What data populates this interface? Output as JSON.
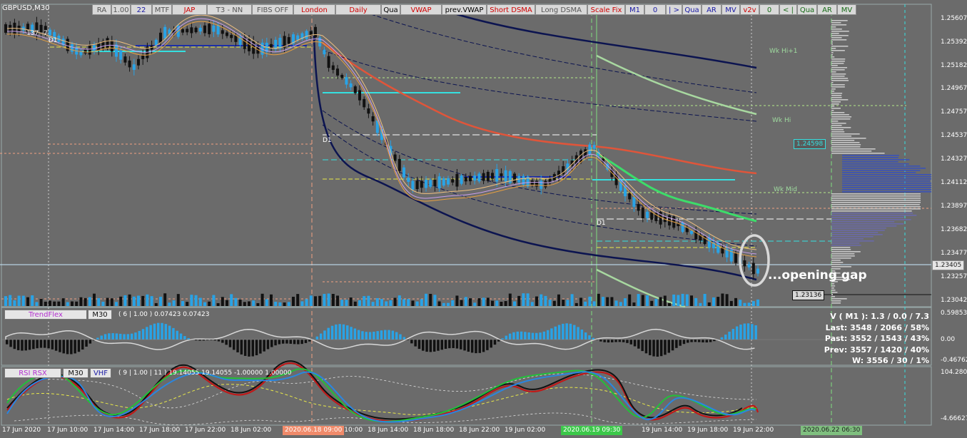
{
  "window": {
    "symbol": "GBPUSD,M30"
  },
  "toolbar": {
    "buttons": [
      "RA",
      "1.00",
      "22",
      "MTF",
      "JAP",
      "T3 - NN",
      "FIBS OFF",
      "London",
      "Daily",
      "Qua",
      "VWAP",
      "prev.VWAP",
      "Short DSMA",
      "Long DSMA",
      "Scale Fix",
      "M1",
      "0",
      "| >",
      "Qua",
      "AR",
      "MV",
      "v2v",
      "0",
      "< |",
      "Qua",
      "AR",
      "MV"
    ]
  },
  "chart": {
    "price_labels": [
      "1.25607",
      "1.25392",
      "1.25182",
      "1.24967",
      "1.24757",
      "1.24537",
      "1.24327",
      "1.24112",
      "1.23897",
      "1.23682",
      "1.23477",
      "1.23257",
      "1.23042"
    ],
    "current_price": "1.23405",
    "tag_blue": "1.24598",
    "tag_low": "1.23136",
    "level_labels": [
      "Wk Hi+1",
      "Wk Hi",
      "Wk Mid"
    ],
    "d1_label": "D1",
    "mini_top": [
      "137",
      "7"
    ],
    "annotation": "...opening gap"
  },
  "trendflex": {
    "name": "TrendFlex",
    "tf": "M30",
    "params": "( 6 | 1.00 ) 0.07423 0.07423",
    "axis": [
      "0.59853",
      "0.00",
      "-0.46762"
    ]
  },
  "rsi": {
    "name": "RSI RSX",
    "tf": "M30",
    "extra": "VHF",
    "params": "( 9 | 1.00 | 11 ) 19.14055 19.14055 -1.00000 1.00000",
    "axis": [
      "104.28033",
      "-4.66627"
    ]
  },
  "stats": {
    "line1": "V ( M1 ): 1.3 / 0.0 / 7.3",
    "line2": "Last: 3548 / 2066 / 58%",
    "line3": "Past: 3552 / 1543 / 43%",
    "line4": "Prev: 3557 / 1420 / 40%",
    "line5": "W: 3556 / 30 / 1%"
  },
  "time_axis": {
    "labels": [
      "17 Jun 2020",
      "17 Jun 10:00",
      "17 Jun 14:00",
      "17 Jun 18:00",
      "17 Jun 22:00",
      "18 Jun 02:00",
      "18 Jun 10:00",
      "18 Jun 14:00",
      "18 Jun 18:00",
      "18 Jun 22:00",
      "19 Jun 02:00",
      "19 Jun 14:00",
      "19 Jun 18:00",
      "19 Jun 22:00"
    ],
    "highlight1": "2020.06.18 09:00",
    "highlight2": "2020.06.19 09:30",
    "highlight3": "2020.06.22 06:30"
  },
  "colors": {
    "background": "#6b6b6b",
    "bull": "#29a3e6",
    "bear": "#111111",
    "vwap_red": "#e0553a",
    "navy": "#0c1450",
    "green": "#3ddc6a",
    "cyan": "#35e0e0"
  }
}
